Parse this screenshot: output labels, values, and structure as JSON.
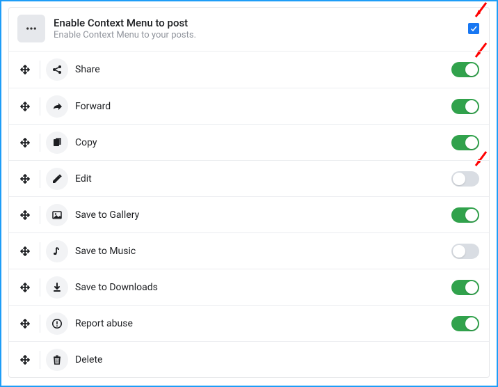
{
  "header": {
    "title": "Enable Context Menu to post",
    "subtitle": "Enable Context Menu to your posts.",
    "checked": true
  },
  "items": [
    {
      "icon": "share-icon",
      "label": "Share",
      "enabled": true,
      "has_toggle": true
    },
    {
      "icon": "forward-icon",
      "label": "Forward",
      "enabled": true,
      "has_toggle": true
    },
    {
      "icon": "copy-icon",
      "label": "Copy",
      "enabled": true,
      "has_toggle": true
    },
    {
      "icon": "edit-icon",
      "label": "Edit",
      "enabled": false,
      "has_toggle": true
    },
    {
      "icon": "gallery-icon",
      "label": "Save to Gallery",
      "enabled": true,
      "has_toggle": true
    },
    {
      "icon": "music-icon",
      "label": "Save to Music",
      "enabled": false,
      "has_toggle": true
    },
    {
      "icon": "download-icon",
      "label": "Save to Downloads",
      "enabled": true,
      "has_toggle": true
    },
    {
      "icon": "report-icon",
      "label": "Report abuse",
      "enabled": true,
      "has_toggle": true
    },
    {
      "icon": "delete-icon",
      "label": "Delete",
      "enabled": false,
      "has_toggle": false
    }
  ],
  "colors": {
    "accent_blue": "#1877f2",
    "toggle_on": "#31a24c",
    "toggle_off": "#d9dde3",
    "arrow": "#ff0000"
  }
}
